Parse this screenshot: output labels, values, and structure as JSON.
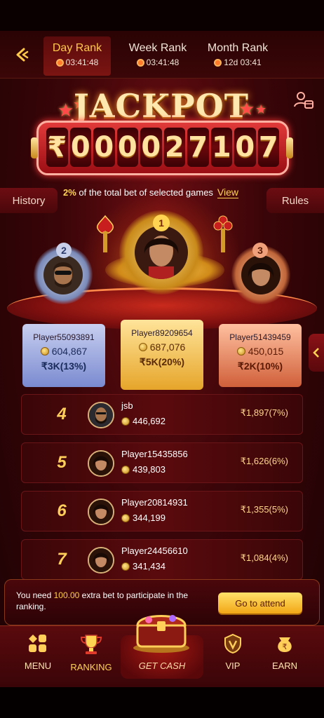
{
  "tabs": [
    {
      "label": "Day Rank",
      "timer": "03:41:48"
    },
    {
      "label": "Week Rank",
      "timer": "03:41:48"
    },
    {
      "label": "Month Rank",
      "timer": "12d 03:41"
    }
  ],
  "jackpot": {
    "title": "JACKPOT",
    "digits": [
      "₹",
      "0",
      "0",
      "0",
      "0",
      "2",
      "7",
      "1",
      "0",
      "7"
    ]
  },
  "side_tabs": {
    "history": "History",
    "rules": "Rules"
  },
  "info": {
    "percent": "2%",
    "text": " of the total bet of selected games",
    "view": "View"
  },
  "podium": [
    {
      "rank": "1",
      "name": "Player89209654",
      "coins": "687,076",
      "prize": "₹5K(20%)"
    },
    {
      "rank": "2",
      "name": "Player55093891",
      "coins": "604,867",
      "prize": "₹3K(13%)"
    },
    {
      "rank": "3",
      "name": "Player51439459",
      "coins": "450,015",
      "prize": "₹2K(10%)"
    }
  ],
  "ranking": [
    {
      "rank": "4",
      "name": "jsb",
      "coins": "446,692",
      "prize": "₹1,897(7%)"
    },
    {
      "rank": "5",
      "name": "Player15435856",
      "coins": "439,803",
      "prize": "₹1,626(6%)"
    },
    {
      "rank": "6",
      "name": "Player20814931",
      "coins": "344,199",
      "prize": "₹1,355(5%)"
    },
    {
      "rank": "7",
      "name": "Player24456610",
      "coins": "341,434",
      "prize": "₹1,084(4%)"
    }
  ],
  "notice": {
    "prefix": "You need ",
    "amount": "100.00",
    "suffix": " extra bet to participate in the ranking.",
    "button": "Go to attend"
  },
  "nav": {
    "menu": "MENU",
    "ranking": "RANKING",
    "get_cash": "GET CASH",
    "vip": "VIP",
    "earn": "EARN"
  },
  "colors": {
    "accent": "#ffd452",
    "background": "#3a0508",
    "gold_card": "#f2c34a",
    "silver_card": "#8a9ad8",
    "bronze_card": "#e08a70"
  }
}
